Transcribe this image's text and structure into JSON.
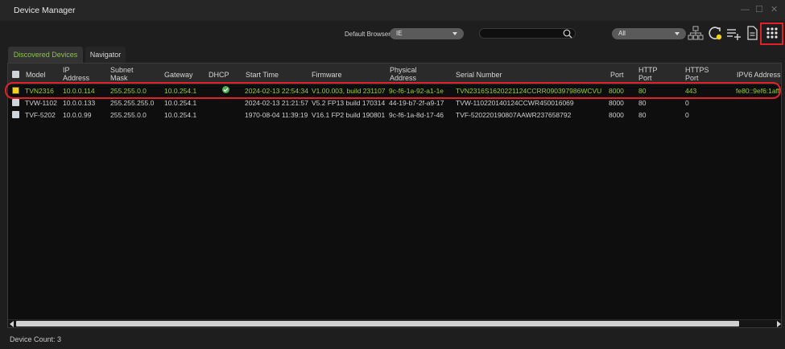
{
  "window": {
    "title": "Device Manager"
  },
  "toolbar": {
    "default_browser_label": "Default Browser",
    "browser_select_value": "IE",
    "filter_select_value": "All",
    "search_placeholder": ""
  },
  "tabs": [
    {
      "label": "Discovered Devices",
      "active": true
    },
    {
      "label": "Navigator",
      "active": false
    }
  ],
  "table": {
    "columns": [
      {
        "l1": "Model",
        "l2": ""
      },
      {
        "l1": "IP",
        "l2": "Address"
      },
      {
        "l1": "Subnet",
        "l2": "Mask"
      },
      {
        "l1": "Gateway",
        "l2": ""
      },
      {
        "l1": "DHCP",
        "l2": ""
      },
      {
        "l1": "Start Time",
        "l2": ""
      },
      {
        "l1": "Firmware",
        "l2": ""
      },
      {
        "l1": "Physical",
        "l2": "Address"
      },
      {
        "l1": "Serial Number",
        "l2": ""
      },
      {
        "l1": "Port",
        "l2": ""
      },
      {
        "l1": "HTTP",
        "l2": "Port"
      },
      {
        "l1": "HTTPS",
        "l2": "Port"
      },
      {
        "l1": "IPV6 Address",
        "l2": ""
      }
    ],
    "rows": [
      {
        "model": "TVN2316",
        "ip": "10.0.0.114",
        "mask": "255.255.0.0",
        "gateway": "10.0.254.1",
        "dhcp": true,
        "start": "2024-02-13 22:54:34",
        "firmware": "V1.00.003, build 231107",
        "mac": "9c-f6-1a-92-a1-1e",
        "serial": "TVN2316S1620221124CCRR090397986WCVU",
        "port": "8000",
        "http": "80",
        "https": "443",
        "ipv6": "fe80::9ef6:1aff",
        "selected": true
      },
      {
        "model": "TVW-1102",
        "ip": "10.0.0.133",
        "mask": "255.255.255.0",
        "gateway": "10.0.254.1",
        "dhcp": false,
        "start": "2024-02-13 21:21:57",
        "firmware": "V5.2 FP13 build 170314",
        "mac": "44-19-b7-2f-a9-17",
        "serial": "TVW-110220140124CCWR450016069",
        "port": "8000",
        "http": "80",
        "https": "0",
        "ipv6": "",
        "selected": false
      },
      {
        "model": "TVF-5202",
        "ip": "10.0.0.99",
        "mask": "255.255.0.0",
        "gateway": "10.0.254.1",
        "dhcp": false,
        "start": "1970-08-04 11:39:19",
        "firmware": "V16.1 FP2 build 190801",
        "mac": "9c-f6-1a-8d-17-46",
        "serial": "TVF-520220190807AAWR237658792",
        "port": "8000",
        "http": "80",
        "https": "0",
        "ipv6": "",
        "selected": false
      }
    ]
  },
  "status": {
    "device_count": "Device Count: 3"
  },
  "colors": {
    "accent_green": "#9ccc3a",
    "highlight_red": "#e0212a"
  }
}
